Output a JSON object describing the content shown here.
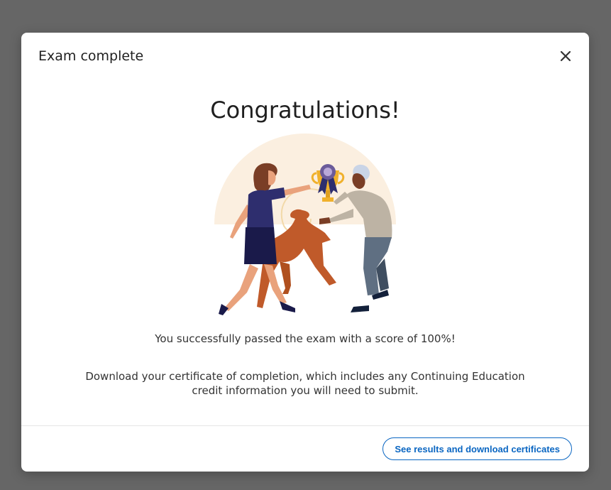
{
  "modal": {
    "title": "Exam complete",
    "close_icon": "close-icon",
    "headline": "Congratulations!",
    "score_message": "You successfully passed the exam with a score of 100%!",
    "certificate_message": "Download your certificate of completion, which includes any Continuing Education credit information you will need to submit.",
    "action_button_label": "See results and download certificates"
  },
  "illustration": {
    "subject": "celebration-illustration",
    "elements": [
      "woman-figure",
      "man-figure",
      "dog-figure",
      "trophy-icon",
      "ribbon-badge-icon"
    ]
  },
  "colors": {
    "backdrop": "#666666",
    "accent": "#0a66c2",
    "illustration_background": "#fbefe0"
  }
}
